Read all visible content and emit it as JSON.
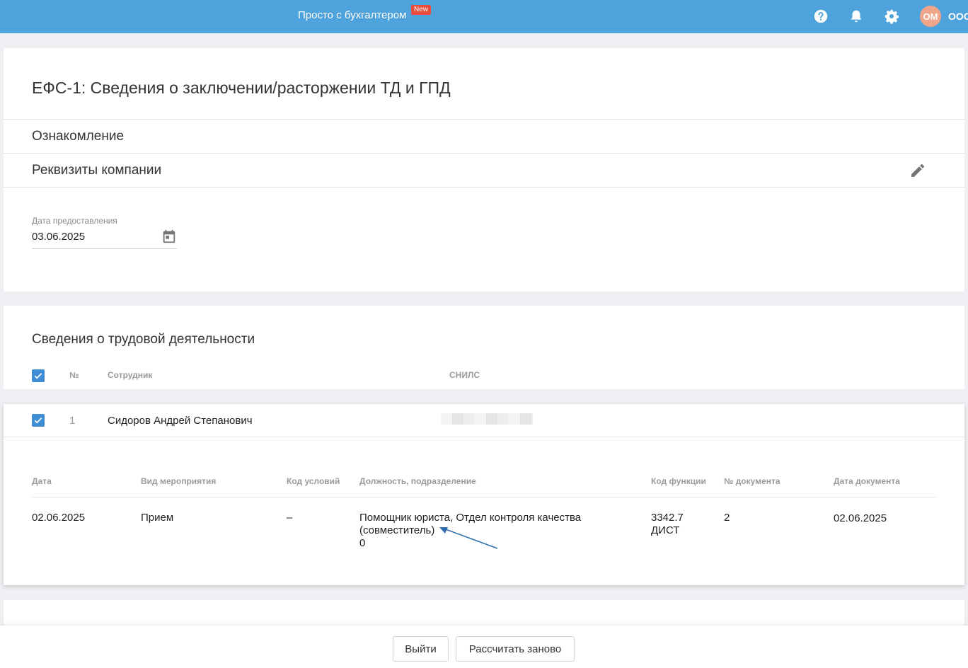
{
  "topbar": {
    "promo": "Просто с бухгалтером",
    "promo_badge": "New",
    "avatar_initials": "ОМ",
    "org": "ООО",
    "icons": [
      "help-icon",
      "bell-icon",
      "gear-icon"
    ],
    "color": "#4fa3dc"
  },
  "report": {
    "title": "ЕФС-1: Сведения о заключении/расторжении ТД и ГПД",
    "section_intro": "Ознакомление",
    "section_company": "Реквизиты компании",
    "date_label": "Дата предоставления",
    "date_value": "03.06.2025"
  },
  "employees": {
    "heading": "Сведения о трудовой деятельности",
    "columns": {
      "num": "№",
      "employee": "Сотрудник",
      "snils": "СНИЛС"
    },
    "rows": [
      {
        "num": "1",
        "name": "Сидоров Андрей Степанович",
        "checked": true
      }
    ]
  },
  "details": {
    "columns": {
      "date": "Дата",
      "event": "Вид мероприятия",
      "cond": "Код условий",
      "position": "Должность, подразделение",
      "func": "Код функции",
      "docnum": "№ документа",
      "docdate": "Дата документа"
    },
    "row": {
      "date": "02.06.2025",
      "event": "Прием",
      "cond": "–",
      "position_line1": "Помощник юриста, Отдел контроля качества",
      "position_line2": "(совместитель)",
      "position_line3": "0",
      "func_line1": "3342.7",
      "func_line2": "ДИСТ",
      "docnum": "2",
      "docdate": "02.06.2025"
    }
  },
  "footer": {
    "exit": "Выйти",
    "recalc": "Рассчитать заново"
  },
  "colors": {
    "accent": "#3f8ed5",
    "badge": "#e74c3c",
    "annotation_arrow": "#2f6fb0"
  }
}
